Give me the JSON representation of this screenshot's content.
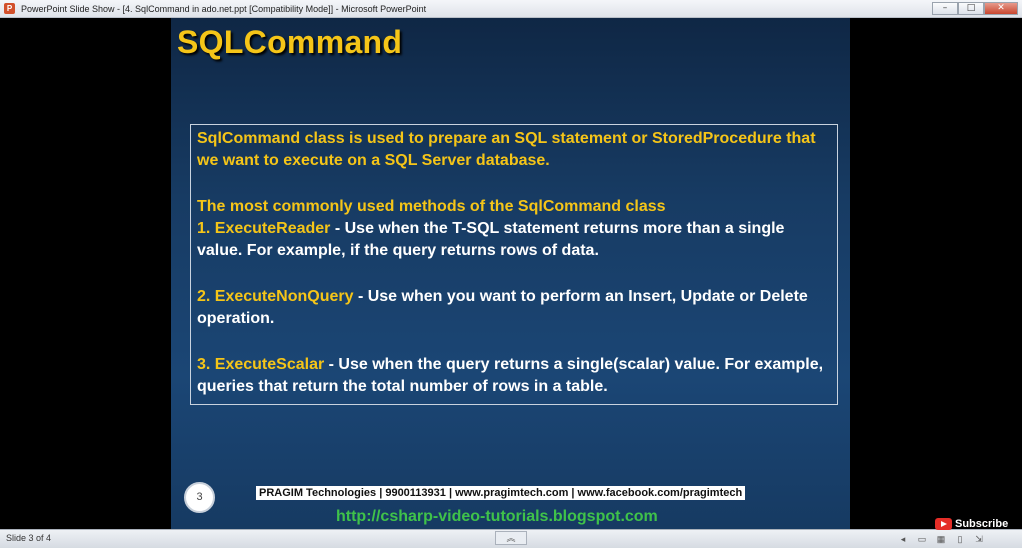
{
  "window": {
    "title": "PowerPoint Slide Show - [4. SqlCommand in ado.net.ppt [Compatibility Mode]] - Microsoft PowerPoint",
    "controls": {
      "minimize": "–",
      "maximize": "□",
      "close": "✕"
    }
  },
  "slide": {
    "title": "SQLCommand",
    "intro": "SqlCommand class is used to prepare an SQL statement or StoredProcedure that we want to execute on a SQL Server database.",
    "methods_heading": "The most commonly used methods of the SqlCommand class",
    "methods": [
      {
        "name": "1. ExecuteReader",
        "description": " - Use when the T-SQL statement returns more than a single value. For example, if the query returns rows of data."
      },
      {
        "name": "2. ExecuteNonQuery",
        "description": " - Use when you want to perform an Insert, Update or Delete operation."
      },
      {
        "name": "3. ExecuteScalar",
        "description": " - Use when the query returns a single(scalar) value. For example, queries that return the total number of rows in a table."
      }
    ],
    "page_number": "3",
    "footer": "PRAGIM Technologies | 9900113931 | www.pragimtech.com | www.facebook.com/pragimtech",
    "blog_link": "http://csharp-video-tutorials.blogspot.com"
  },
  "statusbar": {
    "slide_count": "Slide 3 of 4",
    "collapse": "︽"
  },
  "overlay": {
    "subscribe_label": "Subscribe"
  },
  "colors": {
    "accent_yellow": "#f5c518",
    "link_green": "#3fc24a",
    "slide_bg": "#173b63"
  }
}
